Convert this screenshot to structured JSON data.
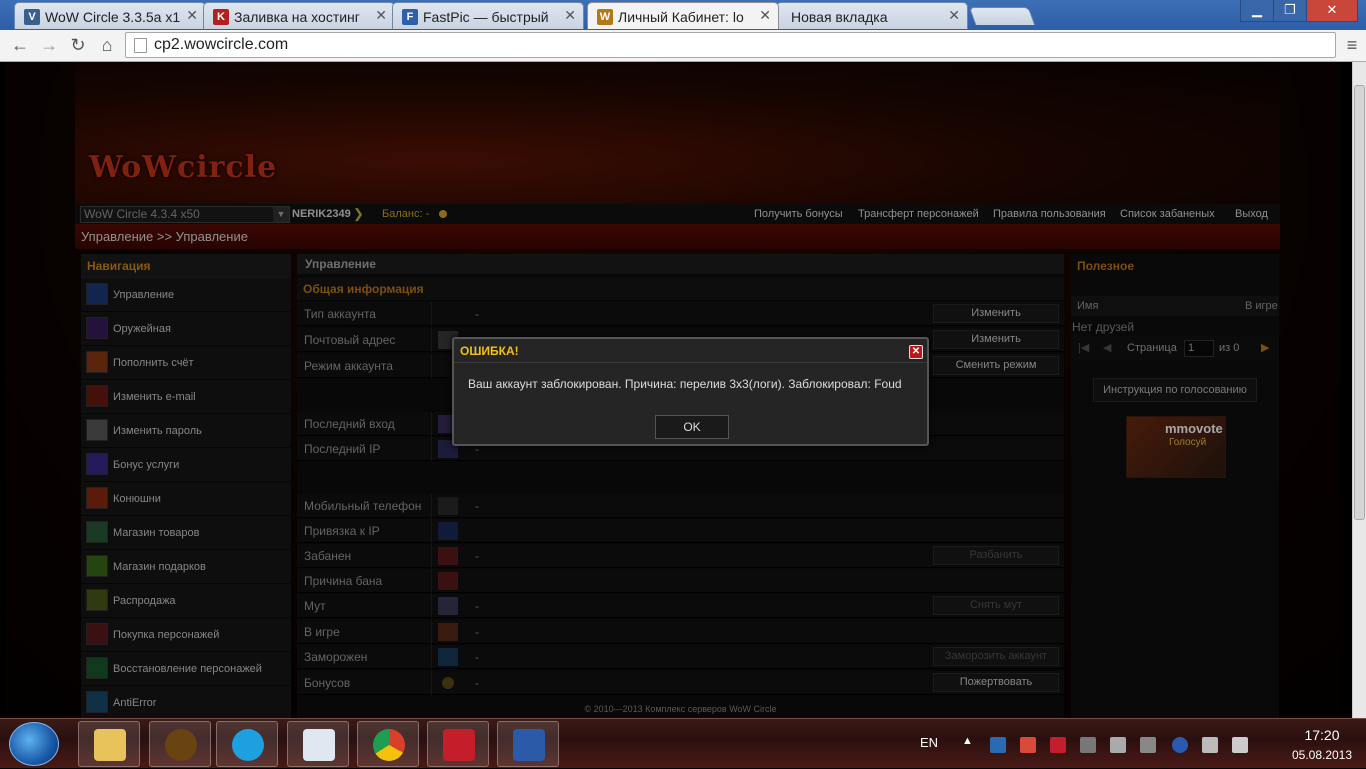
{
  "browser": {
    "tabs": [
      {
        "title": "WoW Circle 3.3.5a x1",
        "fav": "V",
        "color": "#3a5f8a"
      },
      {
        "title": "Заливка на хостинг",
        "fav": "K",
        "color": "#b32020"
      },
      {
        "title": "FastPic — быстрый",
        "fav": "F",
        "color": "#2f5fa8"
      },
      {
        "title": "Личный Кабинет: lo",
        "fav": "W",
        "color": "#b07a1a"
      },
      {
        "title": "Новая вкладка",
        "fav": "",
        "color": "#999999"
      }
    ],
    "url": "cp2.wowcircle.com",
    "window_buttons": [
      "minimize",
      "maximize",
      "close"
    ]
  },
  "site": {
    "logo": "WoWcircle",
    "server_select": "WoW Circle 4.3.4 x50",
    "username": "NERIK2349",
    "balance_label": "Баланс:",
    "balance_value": "-",
    "top_links": [
      "Получить бонусы",
      "Трансферт персонажей",
      "Правила пользования",
      "Список забаненых",
      "Выход"
    ],
    "breadcrumb": "Управление >> Управление",
    "sidebar": {
      "title": "Навигация",
      "items": [
        {
          "label": "Управление",
          "icon": "management-icon"
        },
        {
          "label": "Оружейная",
          "icon": "armory-icon"
        },
        {
          "label": "Пополнить счёт",
          "icon": "deposit-icon"
        },
        {
          "label": "Изменить e-mail",
          "icon": "email-icon"
        },
        {
          "label": "Изменить пароль",
          "icon": "password-icon"
        },
        {
          "label": "Бонус услуги",
          "icon": "bonus-icon"
        },
        {
          "label": "Конюшни",
          "icon": "stables-icon"
        },
        {
          "label": "Магазин товаров",
          "icon": "shop-icon"
        },
        {
          "label": "Магазин подарков",
          "icon": "gift-icon"
        },
        {
          "label": "Распродажа",
          "icon": "sale-icon"
        },
        {
          "label": "Покупка персонажей",
          "icon": "buy-character-icon"
        },
        {
          "label": "Восстановление персонажей",
          "icon": "restore-character-icon"
        },
        {
          "label": "AntiError",
          "icon": "antierror-icon"
        }
      ]
    },
    "main": {
      "title": "Управление",
      "section": "Общая информация",
      "rows": [
        {
          "label": "Тип аккаунта",
          "value": "-",
          "button": "Изменить"
        },
        {
          "label": "Почтовый адрес",
          "value": "",
          "button": "Изменить"
        },
        {
          "label": "Режим аккаунта",
          "value": "",
          "button": "Сменить режим"
        },
        {
          "label": "Последний вход",
          "value": "",
          "button": ""
        },
        {
          "label": "Последний IP",
          "value": "-",
          "button": ""
        },
        {
          "label": "Мобильный телефон",
          "value": "-",
          "button": ""
        },
        {
          "label": "Привязка к IP",
          "value": "",
          "button": ""
        },
        {
          "label": "Забанен",
          "value": "-",
          "button": "Разбанить"
        },
        {
          "label": "Причина бана",
          "value": "",
          "button": ""
        },
        {
          "label": "Мут",
          "value": "-",
          "button": "Снять мут"
        },
        {
          "label": "В игре",
          "value": "-",
          "button": ""
        },
        {
          "label": "Заморожен",
          "value": "-",
          "button": "Заморозить аккаунт"
        },
        {
          "label": "Бонусов",
          "value": "-",
          "button": "Пожертвовать"
        }
      ],
      "footer": "© 2010—2013 Комплекс серверов WoW Circle"
    },
    "right": {
      "title": "Полезное",
      "friends_col_name": "Имя",
      "friends_col_ingame": "В игре",
      "no_friends": "Нет друзей",
      "page_label": "Страница",
      "page_value": "1",
      "page_of": "из 0",
      "vote_button": "Инструкция по голосованию",
      "banner_title": "mmovote",
      "banner_sub": "Голосуй"
    },
    "modal": {
      "title": "ОШИБКА!",
      "message": "Ваш аккаунт заблокирован. Причина: перелив 3х3(логи). Заблокировал: Foud",
      "ok": "OK"
    }
  },
  "taskbar": {
    "apps": [
      {
        "name": "explorer",
        "color": "#e8c25a"
      },
      {
        "name": "wow",
        "color": "#6a4410"
      },
      {
        "name": "skype",
        "color": "#1d9fe0"
      },
      {
        "name": "notepad",
        "color": "#dfe8f0"
      },
      {
        "name": "chrome",
        "color": "#d9402a"
      },
      {
        "name": "kaspersky",
        "color": "#c41e2a"
      },
      {
        "name": "word",
        "color": "#2b5aa8"
      }
    ],
    "lang": "EN",
    "time": "17:20",
    "date": "05.08.2013"
  }
}
